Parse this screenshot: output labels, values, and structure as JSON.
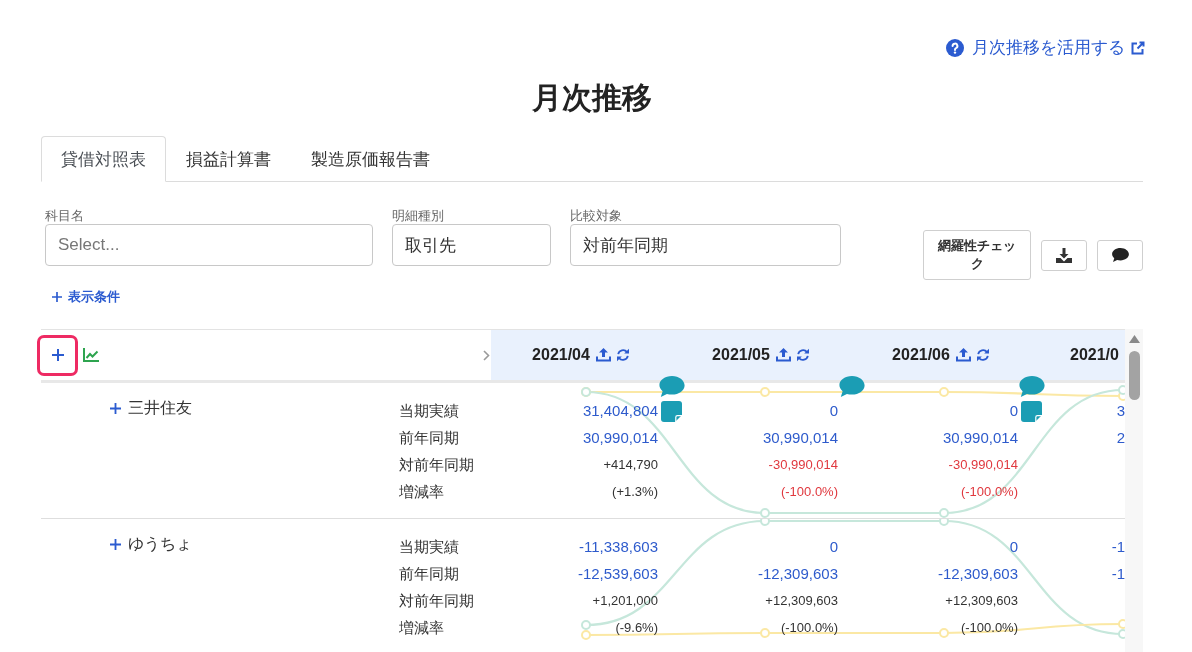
{
  "help_link": {
    "label": "月次推移を活用する"
  },
  "title": "月次推移",
  "tabs": [
    {
      "label": "貸借対照表",
      "selected": true
    },
    {
      "label": "損益計算書",
      "selected": false
    },
    {
      "label": "製造原価報告書",
      "selected": false
    }
  ],
  "filters": [
    {
      "label": "科目名",
      "placeholder": "Select..."
    },
    {
      "label": "明細種別",
      "value": "取引先"
    },
    {
      "label": "比較対象",
      "value": "対前年同期"
    }
  ],
  "actions": {
    "check_button": "網羅性チェック"
  },
  "display_conditions": {
    "label": "表示条件"
  },
  "table": {
    "expand_all": {
      "highlighted": true
    },
    "chart": {
      "on": true
    },
    "months": [
      {
        "label": "2021/04",
        "partial": false
      },
      {
        "label": "2021/05",
        "partial": false
      },
      {
        "label": "2021/06",
        "partial": false
      },
      {
        "label": "2021/0",
        "partial": true
      }
    ],
    "groups": [
      {
        "name": "三井住友",
        "markers": [
          {
            "comment": true,
            "note": true
          },
          {
            "comment": true,
            "note": false
          },
          {
            "comment": true,
            "note": true
          },
          {
            "comment": false,
            "note": false
          }
        ],
        "rows": [
          {
            "label": "当期実績",
            "kind": "amount",
            "values": [
              "31,404,804",
              "0",
              "0",
              "3"
            ]
          },
          {
            "label": "前年同期",
            "kind": "amount",
            "values": [
              "30,990,014",
              "30,990,014",
              "30,990,014",
              "2"
            ]
          },
          {
            "label": "対前年同期",
            "kind": "change",
            "values": [
              {
                "text": "+414,790",
                "negative": false
              },
              {
                "text": "-30,990,014",
                "negative": true
              },
              {
                "text": "-30,990,014",
                "negative": true
              }
            ]
          },
          {
            "label": "増減率",
            "kind": "change",
            "values": [
              {
                "text": "(+1.3%)",
                "negative": false
              },
              {
                "text": "(-100.0%)",
                "negative": true
              },
              {
                "text": "(-100.0%)",
                "negative": true
              }
            ]
          }
        ]
      },
      {
        "name": "ゆうちょ",
        "markers": [
          {
            "comment": false,
            "note": false
          },
          {
            "comment": false,
            "note": false
          },
          {
            "comment": false,
            "note": false
          },
          {
            "comment": false,
            "note": false
          }
        ],
        "rows": [
          {
            "label": "当期実績",
            "kind": "amount",
            "values": [
              "-11,338,603",
              "0",
              "0",
              "-1"
            ]
          },
          {
            "label": "前年同期",
            "kind": "amount",
            "values": [
              "-12,539,603",
              "-12,309,603",
              "-12,309,603",
              "-1"
            ]
          },
          {
            "label": "対前年同期",
            "kind": "change",
            "values": [
              {
                "text": "+1,201,000",
                "negative": false
              },
              {
                "text": "+12,309,603",
                "negative": false
              },
              {
                "text": "+12,309,603",
                "negative": false
              }
            ]
          },
          {
            "label": "増減率",
            "kind": "change",
            "values": [
              {
                "text": "(-9.6%)",
                "negative": false
              },
              {
                "text": "(-100.0%)",
                "negative": false
              },
              {
                "text": "(-100.0%)",
                "negative": false
              }
            ]
          }
        ]
      }
    ]
  }
}
